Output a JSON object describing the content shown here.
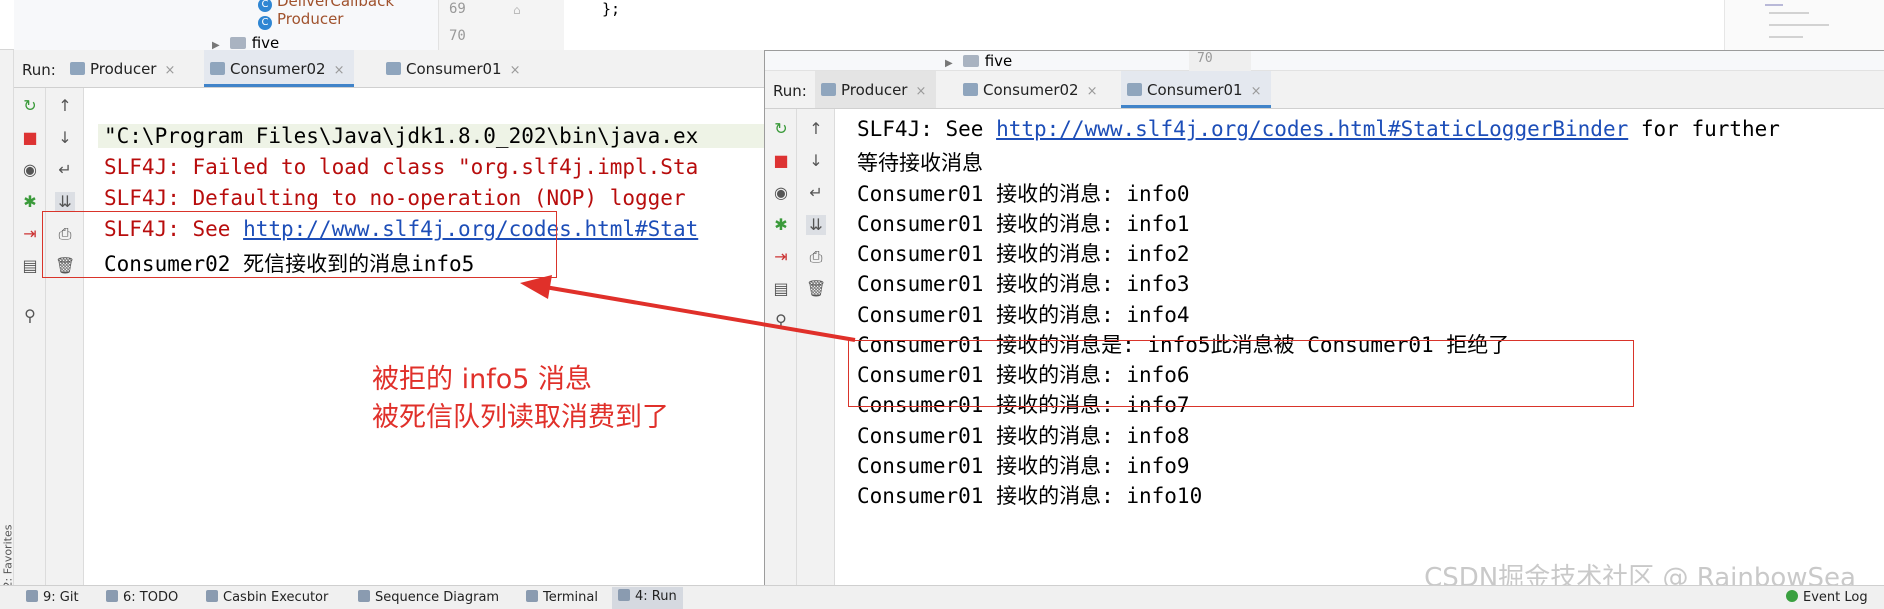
{
  "editor": {
    "tree": {
      "cut_item": "DeliverCallback",
      "producer_item": "Producer",
      "five_folder": "five",
      "class_badge": "C"
    },
    "line_numbers": [
      "69",
      "70"
    ],
    "code_line": "};"
  },
  "left_sidebar": {
    "favorites_label": "2: Favorites"
  },
  "run_back": {
    "run_label": "Run:",
    "tabs": [
      {
        "label": "Producer",
        "close": "×"
      },
      {
        "label": "Consumer02",
        "close": "×"
      },
      {
        "label": "Consumer01",
        "close": "×"
      }
    ],
    "console": {
      "line1": "\"C:\\Program Files\\Java\\jdk1.8.0_202\\bin\\java.ex",
      "line2": "SLF4J: Failed to load class \"org.slf4j.impl.Sta",
      "line3": "SLF4J: Defaulting to no-operation (NOP) logger",
      "line4_prefix": "SLF4J: See ",
      "line4_link": "http://www.slf4j.org/codes.html#Stat",
      "line5": "Consumer02 死信接收到的消息info5"
    }
  },
  "run_front": {
    "tree_folder": "five",
    "tree_line_number": "70",
    "run_label": "Run:",
    "tabs": [
      {
        "label": "Producer",
        "close": "×"
      },
      {
        "label": "Consumer02",
        "close": "×"
      },
      {
        "label": "Consumer01",
        "close": "×"
      }
    ],
    "console": {
      "slf_prefix": "SLF4J: See ",
      "slf_link": "http://www.slf4j.org/codes.html#StaticLoggerBinder",
      "slf_suffix": " for further",
      "waiting": "等待接收消息",
      "lines": [
        "Consumer01 接收的消息: info0",
        "Consumer01 接收的消息: info1",
        "Consumer01 接收的消息: info2",
        "Consumer01 接收的消息: info3",
        "Consumer01 接收的消息: info4",
        "Consumer01 接收的消息是: info5此消息被 Consumer01 拒绝了",
        "Consumer01 接收的消息: info6",
        "Consumer01 接收的消息: info7",
        "Consumer01 接收的消息: info8",
        "Consumer01 接收的消息: info9",
        "Consumer01 接收的消息: info10"
      ]
    }
  },
  "annotation": {
    "line1": "被拒的 info5 消息",
    "line2": "被死信队列读取消费到了",
    "color": "#e0302a"
  },
  "bottom_bar": {
    "items": [
      "9: Git",
      "6: TODO",
      "Casbin Executor",
      "Sequence Diagram",
      "Terminal",
      "4: Run"
    ],
    "event_log": "Event Log"
  },
  "watermark": "CSDN掘金技术社区 @ RainbowSea"
}
